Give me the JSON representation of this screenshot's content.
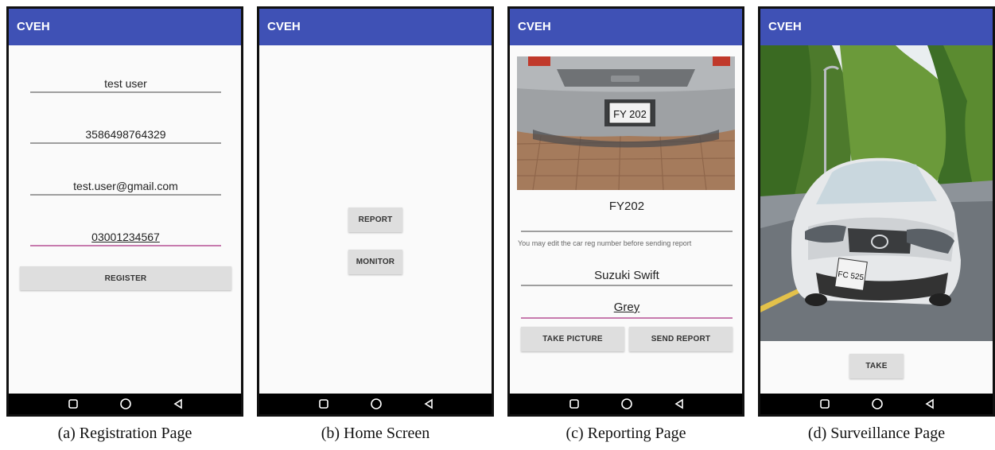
{
  "app_title": "CVEH",
  "registration": {
    "name_value": "test user",
    "cnic_value": "3586498764329",
    "email_value": "test.user@gmail.com",
    "phone_value": "03001234567",
    "register_label": "REGISTER"
  },
  "home": {
    "report_label": "REPORT",
    "monitor_label": "MONITOR"
  },
  "reporting": {
    "plate_in_photo": "FY 202",
    "plate_value": "FY202",
    "edit_hint": "You may edit the car reg number before sending report",
    "model_value": "Suzuki Swift",
    "color_value": "Grey",
    "take_picture_label": "TAKE PICTURE",
    "send_report_label": "SEND REPORT"
  },
  "surveillance": {
    "plate_in_photo": "FC 525",
    "take_label": "TAKE"
  },
  "captions": {
    "a": "(a) Registration Page",
    "b": "(b) Home Screen",
    "c": "(c) Reporting Page",
    "d": "(d) Surveillance Page"
  },
  "colors": {
    "appbar": "#3f51b5",
    "focused_underline": "#c77bae",
    "button_bg": "#dedede"
  },
  "icons": [
    "square-recent-apps-icon",
    "circle-home-icon",
    "triangle-back-icon"
  ]
}
